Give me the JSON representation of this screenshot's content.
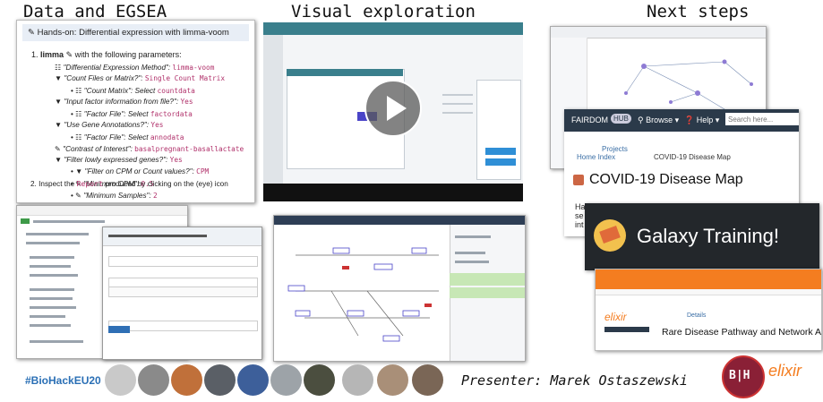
{
  "headings": {
    "left": "Data and EGSEA",
    "center": "Visual exploration",
    "right": "Next steps"
  },
  "handson": {
    "title": "Hands-on: Differential expression with limma-voom",
    "step1_num": "1.",
    "step1_tool": "limma",
    "step1_rest": "with the following parameters:",
    "items": [
      {
        "label": "\"Differential Expression Method\":",
        "value": "limma-voom"
      },
      {
        "label": "\"Count Files or Matrix?\":",
        "value": "Single Count Matrix"
      },
      {
        "label": "\"Count Matrix\": Select",
        "value": "countdata"
      },
      {
        "label": "\"Input factor information from file?\":",
        "value": "Yes"
      },
      {
        "label": "\"Factor File\": Select",
        "value": "factordata"
      },
      {
        "label": "\"Use Gene Annotations?\":",
        "value": "Yes"
      },
      {
        "label": "\"Factor File\": Select",
        "value": "annodata"
      },
      {
        "label": "\"Contrast of Interest\":",
        "value": "basalpregnant-basallactate"
      },
      {
        "label": "\"Filter lowly expressed genes?\":",
        "value": "Yes"
      },
      {
        "label": "\"Filter on CPM or Count values?\":",
        "value": "CPM"
      },
      {
        "label": "\"Minimum CPM\":",
        "value": "0.5"
      },
      {
        "label": "\"Minimum Samples\":",
        "value": "2"
      }
    ],
    "step2_num": "2.",
    "step2_pre": "Inspect the",
    "step2_code": "Report",
    "step2_post": "produced by clicking on the (eye) icon"
  },
  "fairdom": {
    "brand": "FAIRDOM",
    "hub": "HUB",
    "browse": "Browse",
    "help": "Help",
    "search_placeholder": "Search here...",
    "crumb_projects": "Projects",
    "crumb_home": "Home Index",
    "crumb_page": "COVID-19 Disease Map",
    "title": "COVID-19 Disease Map",
    "frag1": "Ha",
    "frag2": "se",
    "frag3": "int"
  },
  "galaxy_training": {
    "label": "Galaxy Training!"
  },
  "elixir_page": {
    "title": "Rare Disease Pathway and Network Analysis",
    "tab": "Details"
  },
  "footer": {
    "hashtag": "#BioHackEU20",
    "presenter": "Presenter: Marek Ostaszewski",
    "bih": "B|H",
    "elixir": "elixir"
  },
  "colors": {
    "handson_bg": "#e8eef6",
    "code_pink": "#b0306a",
    "hashtag_blue": "#2a6fb5",
    "galaxy_bg": "#23272b",
    "fairdom_bar": "#2b3a4a",
    "elixir_orange": "#f47d20"
  },
  "icons": [
    "pencil-icon",
    "filter-icon",
    "file-icon",
    "play-icon",
    "search-icon",
    "galaxy-logo-icon",
    "bih-logo",
    "elixir-logo"
  ]
}
